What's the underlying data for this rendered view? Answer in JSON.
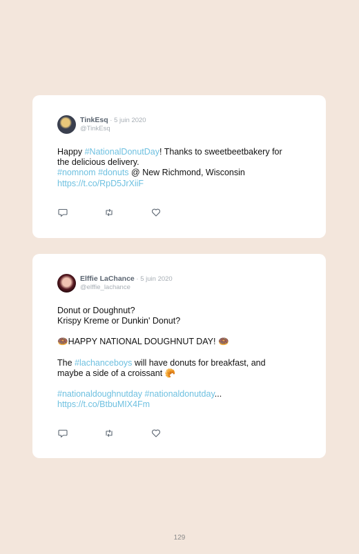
{
  "tweets": [
    {
      "name": "TinkEsq",
      "date": " · 5 juin 2020",
      "handle": "@TinkEsq",
      "lines": {
        "l1_a": "Happy ",
        "l1_tag": "#NationalDonutDay",
        "l1_b": "! Thanks to sweetbeetbakery for",
        "l2": "the delicious delivery.",
        "l3_tag1": "#nomnom",
        "l3_sp": " ",
        "l3_tag2": "#donuts",
        "l3_b": " @ New Richmond, Wisconsin",
        "l4_link": "https://t.co/RpD5JrXiiF"
      }
    },
    {
      "name": "Elffie LaChance",
      "date": " · 5 juin 2020",
      "handle": "@elffie_lachance",
      "lines": {
        "l1": "Donut or Doughnut?",
        "l2": "Krispy Kreme or Dunkin' Donut?",
        "l3": "🍩HAPPY NATIONAL DOUGHNUT DAY! 🍩",
        "l4_a": "The ",
        "l4_tag": "#lachanceboys",
        "l4_b": " will have donuts for breakfast, and",
        "l5": "maybe a side of a croissant 🥐",
        "l6_tag1": "#nationaldoughnutday",
        "l6_sp": " ",
        "l6_tag2": "#nationaldonutday",
        "l6_ellipsis": "...",
        "l7_link": "https://t.co/BtbuMIX4Fm"
      }
    }
  ],
  "page_number": "129",
  "colors": {
    "background": "#f3e6dc",
    "card": "#ffffff",
    "link": "#6ec0e0",
    "name": "#5a6470",
    "muted": "#a7aeb5"
  },
  "icons": [
    "reply-icon",
    "retweet-icon",
    "like-icon"
  ]
}
